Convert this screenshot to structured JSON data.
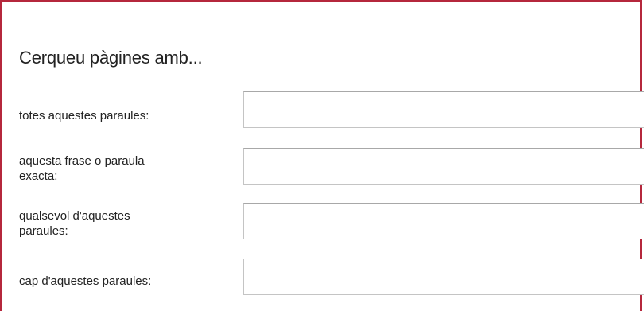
{
  "form": {
    "heading": "Cerqueu pàgines amb...",
    "fields": [
      {
        "label": "totes aquestes paraules:",
        "value": "",
        "placeholder": ""
      },
      {
        "label_line1": "aquesta frase o paraula",
        "label_line2": "exacta:",
        "value": "",
        "placeholder": ""
      },
      {
        "label_line1": "qualsevol d'aquestes",
        "label_line2": "paraules:",
        "value": "",
        "placeholder": ""
      },
      {
        "label": "cap d'aquestes paraules:",
        "value": "",
        "placeholder": ""
      }
    ]
  },
  "colors": {
    "frame_border": "#b5273c",
    "input_border": "#c4c4c4",
    "text": "#222222"
  }
}
